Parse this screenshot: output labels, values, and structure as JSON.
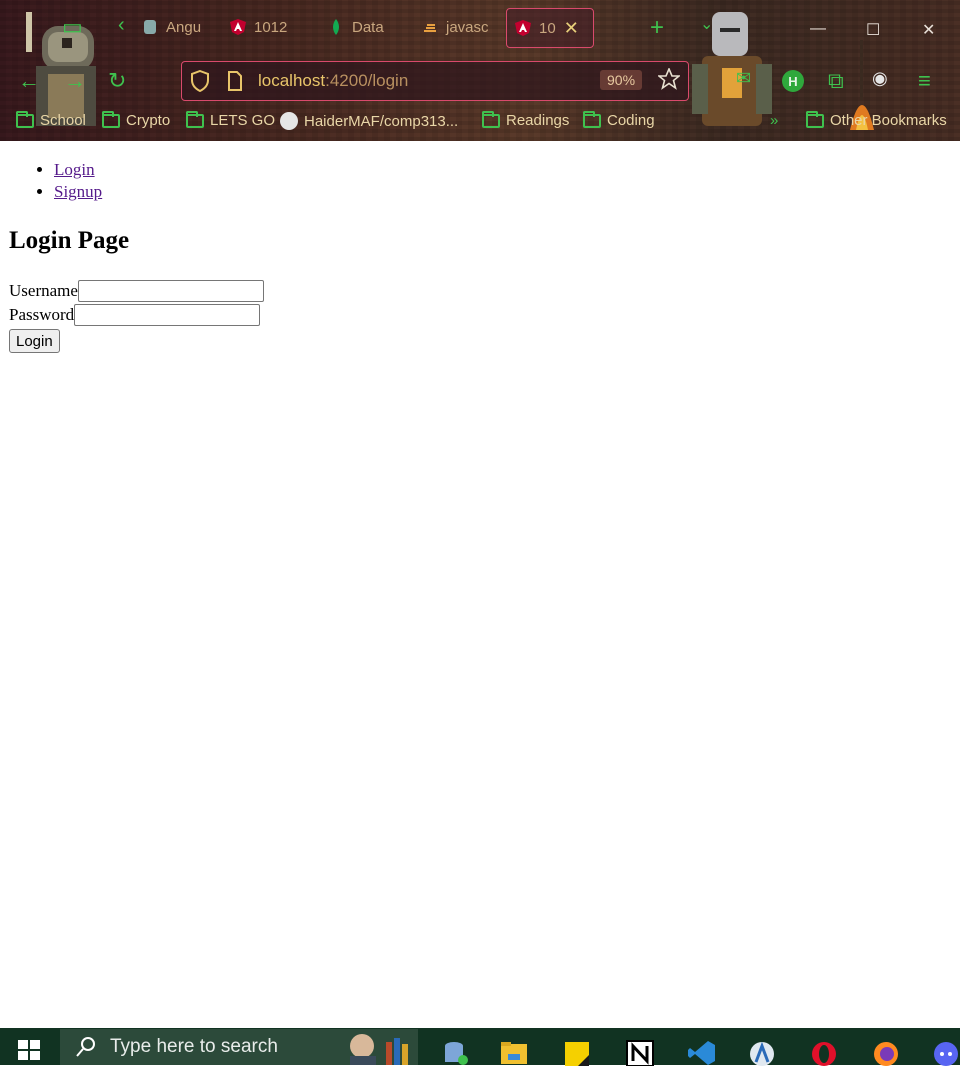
{
  "browser": {
    "tabs": [
      {
        "label": "Angul",
        "icon": "angular-docs-icon"
      },
      {
        "label": "1012",
        "icon": "angular-icon"
      },
      {
        "label": "Data",
        "icon": "mongodb-icon"
      },
      {
        "label": "javasc",
        "icon": "stackoverflow-icon"
      },
      {
        "label": "10",
        "icon": "angular-icon",
        "active": true
      }
    ],
    "address": {
      "host": "localhost",
      "path": ":4200/login",
      "zoom": "90%"
    },
    "profile_initial": "H",
    "bookmarks": [
      {
        "label": "School"
      },
      {
        "label": "Crypto"
      },
      {
        "label": "LETS GO"
      },
      {
        "label": "HaiderMAF/comp313..."
      },
      {
        "label": "Readings"
      },
      {
        "label": "Coding"
      }
    ],
    "other_bookmarks": "Other Bookmarks",
    "colors": {
      "accent": "#3fc14e",
      "tab_border": "#d94a6c",
      "url_text": "#e8c56a"
    }
  },
  "page": {
    "nav": [
      {
        "label": "Login"
      },
      {
        "label": "Signup"
      }
    ],
    "title": "Login Page",
    "username_label": "Username",
    "username_value": "",
    "password_label": "Password",
    "password_value": "",
    "submit_label": "Login"
  },
  "taskbar": {
    "search_placeholder": "Type here to search",
    "apps": [
      "file-explorer-icon",
      "sticky-notes-icon",
      "notion-icon",
      "vscode-icon",
      "android-studio-icon",
      "opera-icon",
      "firefox-icon",
      "discord-icon"
    ]
  }
}
